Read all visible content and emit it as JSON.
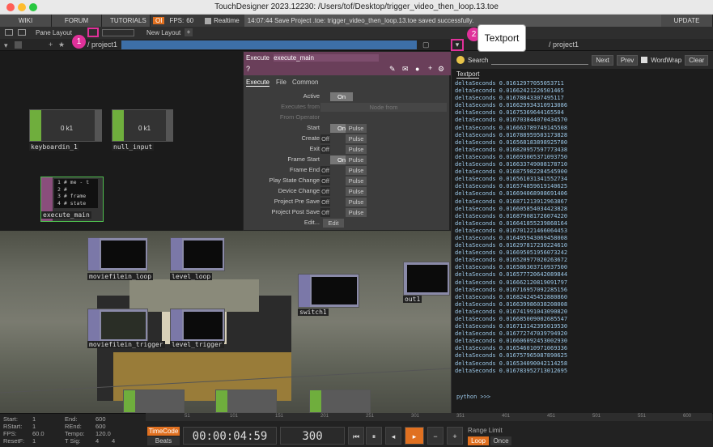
{
  "window": {
    "title": "TouchDesigner 2023.12230: /Users/tof/Desktop/trigger_video_then_loop.13.toe"
  },
  "menu": {
    "wiki": "WIKI",
    "forum": "FORUM",
    "tutorials": "TUTORIALS",
    "oi": "OI",
    "fps_label": "FPS:",
    "fps_value": "60",
    "realtime": "Realtime",
    "status": "14:07:44 Save Project .toe: trigger_video_then_loop.13.toe saved successfully.",
    "update": "UPDATE"
  },
  "toolbar": {
    "pane_layout": "Pane Layout",
    "new_layout": "New Layout",
    "path_left": "/ project1",
    "path_right": "/ project1"
  },
  "nodes": {
    "keyboardin": {
      "label": "keyboardin_1",
      "value": "0 k1"
    },
    "null_input": {
      "label": "null_input",
      "value": "0 k1"
    },
    "execute_main": {
      "label": "execute_main",
      "code": [
        "1 # me - t",
        "2 #",
        "3 # frame",
        "4 # state"
      ]
    },
    "moviefilein_loop": {
      "label": "moviefilein_loop"
    },
    "level_loop": {
      "label": "level_loop"
    },
    "switch1": {
      "label": "switch1"
    },
    "out1": {
      "label": "out1"
    },
    "moviefilein_trigger": {
      "label": "moviefilein_trigger"
    },
    "level_trigger": {
      "label": "level_trigger"
    }
  },
  "panel": {
    "type": "Execute",
    "name": "execute_main",
    "tabs": [
      "Execute",
      "File",
      "Common"
    ],
    "rows": [
      {
        "label": "Active",
        "state": "On"
      },
      {
        "label": "Executes from",
        "state": "Node from"
      },
      {
        "label": "From Operator",
        "state": ""
      },
      {
        "label": "Start",
        "state": "On",
        "pulse": "Pulse"
      },
      {
        "label": "Create",
        "state": "Off",
        "pulse": "Pulse"
      },
      {
        "label": "Exit",
        "state": "Off",
        "pulse": "Pulse"
      },
      {
        "label": "Frame Start",
        "state": "On",
        "pulse": "Pulse"
      },
      {
        "label": "Frame End",
        "state": "Off",
        "pulse": "Pulse"
      },
      {
        "label": "Play State Change",
        "state": "Off",
        "pulse": "Pulse"
      },
      {
        "label": "Device Change",
        "state": "Off",
        "pulse": "Pulse"
      },
      {
        "label": "Project Pre Save",
        "state": "Off",
        "pulse": "Pulse"
      },
      {
        "label": "Project Post Save",
        "state": "Off",
        "pulse": "Pulse"
      },
      {
        "label": "Edit...",
        "state": "Edit"
      }
    ]
  },
  "textport": {
    "tooltip": "Textport",
    "search": "Search",
    "next": "Next",
    "prev": "Prev",
    "wordwrap": "WordWrap",
    "clear": "Clear",
    "tab": "Textport",
    "lines": [
      "deltaSeconds 0.01612977055053711",
      "deltaSeconds 0.01662421226501465",
      "deltaSeconds 0.01678843307495117",
      "deltaSeconds 0.016629934310913086",
      "deltaSeconds 0.01675369644165504",
      "deltaSeconds 0.016703844070434570",
      "deltaSeconds 0.016663789749145508",
      "deltaSeconds 0.016788959503173828",
      "deltaSeconds 0.016568183898925780",
      "deltaSeconds 0.016820957597773438",
      "deltaSeconds 0.016693005371093750",
      "deltaSeconds 0.016633749008178710",
      "deltaSeconds 0.016875982284545900",
      "deltaSeconds 0.016561031341552734",
      "deltaSeconds 0.016574859619140625",
      "deltaSeconds 0.016694068908691406",
      "deltaSeconds 0.016871213912963867",
      "deltaSeconds 0.016605854034423828",
      "deltaSeconds 0.016879081726074220",
      "deltaSeconds 0.016641855239868164",
      "deltaSeconds 0.016701221466064453",
      "deltaSeconds 0.016495943069458008",
      "deltaSeconds 0.016297817230224610",
      "deltaSeconds 0.016695051956073242",
      "deltaSeconds 0.016520977020263672",
      "deltaSeconds 0.016586303710937500",
      "deltaSeconds 0.016577720642089844",
      "deltaSeconds 0.016662120819091797",
      "deltaSeconds 0.016716957092285156",
      "deltaSeconds 0.016824245452880860",
      "deltaSeconds 0.016639986038208008",
      "deltaSeconds 0.016741991043090820",
      "deltaSeconds 0.016685009002685547",
      "deltaSeconds 0.016713142395019530",
      "deltaSeconds 0.016772747039794920",
      "deltaSeconds 0.016606092453002930",
      "deltaSeconds 0.016546010971069336",
      "deltaSeconds 0.016757965087890625",
      "deltaSeconds 0.016534090042114258",
      "deltaSeconds 0.016783952713012695"
    ],
    "prompt": "python >>>"
  },
  "timeline": {
    "start_label": "Start:",
    "start": "1",
    "end_label": "End:",
    "end": "600",
    "rstart_label": "RStart:",
    "rstart": "1",
    "rend_label": "REnd:",
    "rend": "600",
    "fps_label": "FPS:",
    "fps": "60.0",
    "tempo_label": "Tempo:",
    "tempo": "120.0",
    "resetf_label": "ResetF:",
    "resetf": "1",
    "tsig_label": "T Sig:",
    "tsig_a": "4",
    "tsig_b": "4",
    "timecode": "TimeCode",
    "beats": "Beats",
    "time": "00:00:04:59",
    "frame": "300",
    "range_limit": "Range Limit",
    "loop": "Loop",
    "once": "Once",
    "ruler": [
      "51",
      "101",
      "151",
      "201",
      "251",
      "301",
      "351",
      "401",
      "451",
      "501",
      "551",
      "600"
    ]
  },
  "annotations": {
    "a1": "1",
    "a2": "2"
  }
}
